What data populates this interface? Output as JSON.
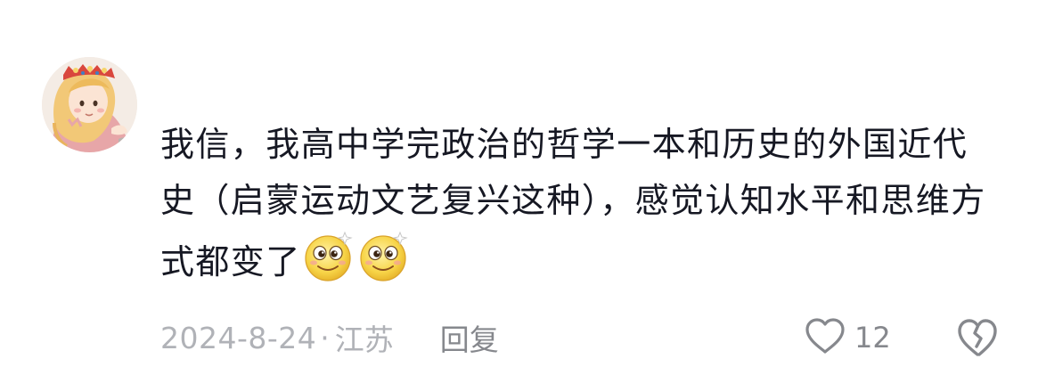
{
  "comment": {
    "text": "我信，我高中学完政治的哲学一本和历史的外国近代史（启蒙运动文艺复兴这种），感觉认知水平和思维方式都变了",
    "emojis": [
      "smile-emoji",
      "smile-emoji"
    ],
    "date": "2024-8-24",
    "separator": "·",
    "location": "江苏",
    "reply_label": "回复",
    "like_count": "12"
  },
  "colors": {
    "text": "#161823",
    "meta": "#b0b2b7",
    "action": "#86888d"
  }
}
